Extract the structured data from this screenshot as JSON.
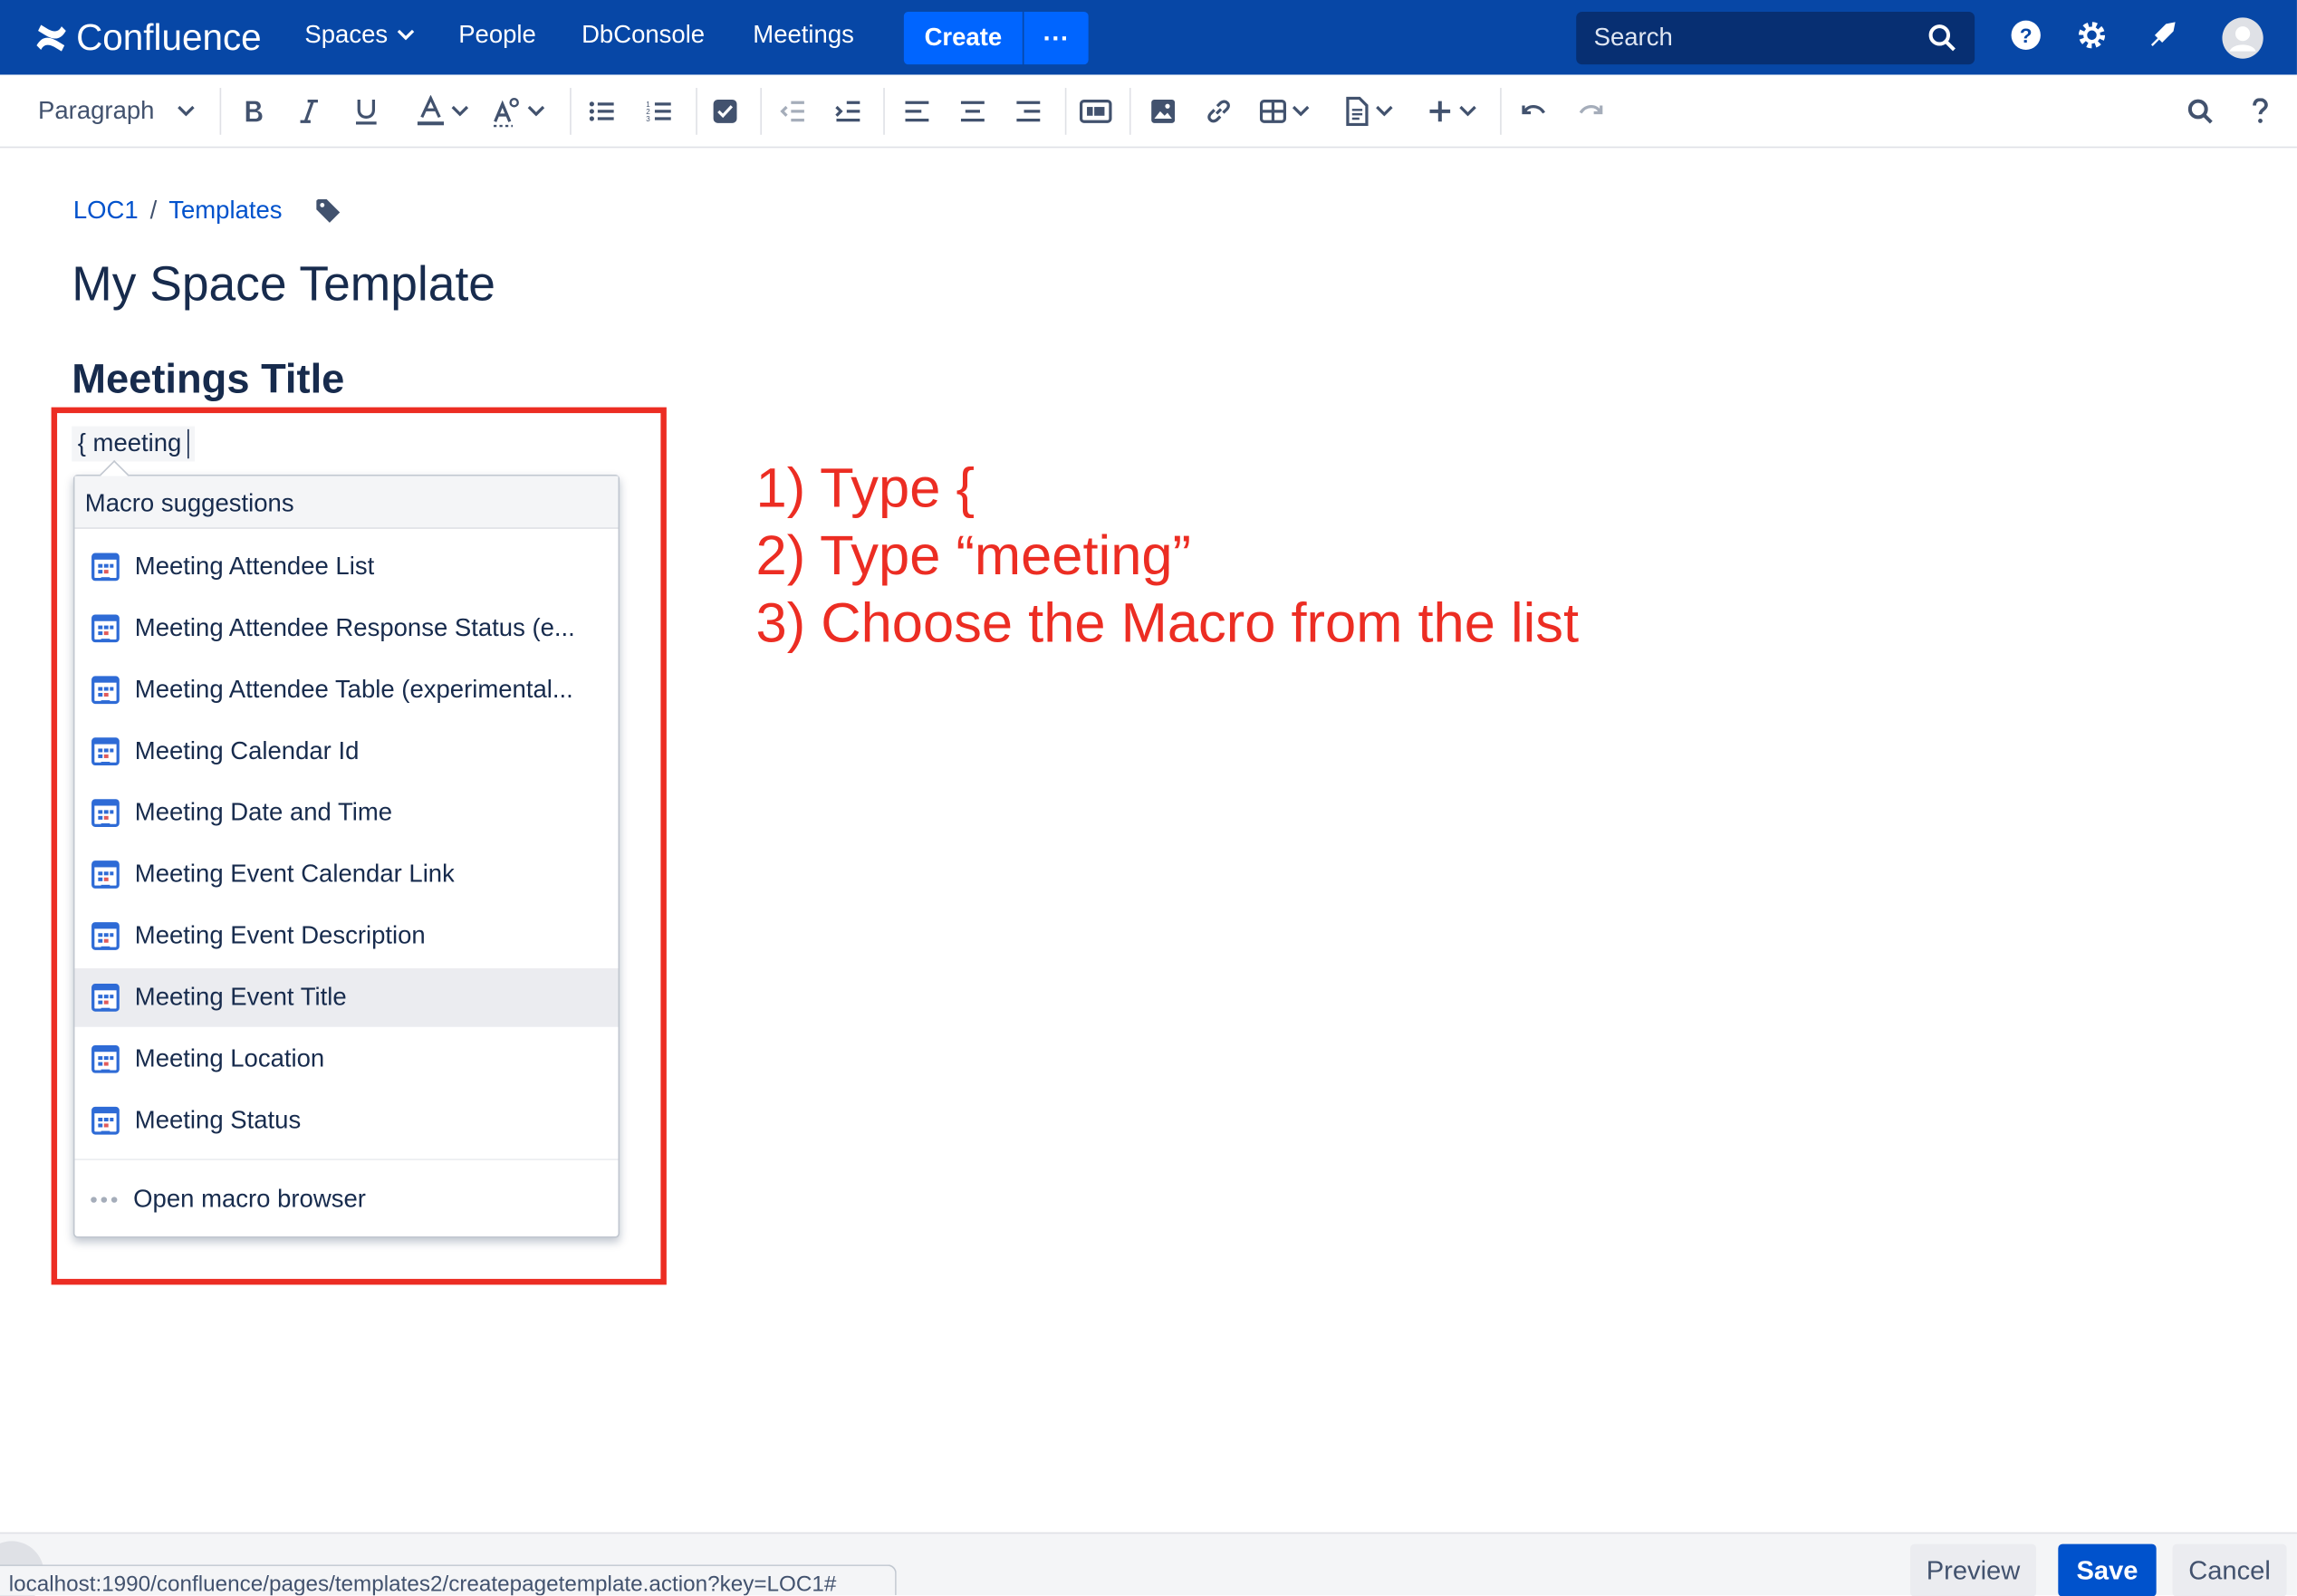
{
  "nav": {
    "product": "Confluence",
    "spaces": "Spaces",
    "people": "People",
    "dbconsole": "DbConsole",
    "meetings": "Meetings",
    "create": "Create",
    "more": "···",
    "search_placeholder": "Search"
  },
  "toolbar": {
    "paragraph": "Paragraph"
  },
  "breadcrumb": {
    "space": "LOC1",
    "separator": "/",
    "templates": "Templates"
  },
  "page": {
    "title": "My Space Template",
    "heading": "Meetings Title",
    "typed_text": "{ meeting"
  },
  "macro_suggestions": {
    "header": "Macro suggestions",
    "items": [
      "Meeting Attendee List",
      "Meeting Attendee Response Status (e...",
      "Meeting Attendee Table (experimental...",
      "Meeting Calendar Id",
      "Meeting Date and Time",
      "Meeting Event Calendar Link",
      "Meeting Event Description",
      "Meeting Event Title",
      "Meeting Location",
      "Meeting Status"
    ],
    "highlighted_index": 7,
    "open_browser": "Open macro browser"
  },
  "instructions": [
    "1) Type {",
    "2) Type “meeting”",
    "3) Choose the Macro from the list"
  ],
  "footer": {
    "preview": "Preview",
    "save": "Save",
    "cancel": "Cancel"
  },
  "status_url": "localhost:1990/confluence/pages/templates2/createpagetemplate.action?key=LOC1#",
  "colors": {
    "nav_bg": "#0747a6",
    "create_btn": "#0065ff",
    "link": "#0052cc",
    "annotation_red": "#ec2d23",
    "highlight_row": "#ebecf0"
  }
}
